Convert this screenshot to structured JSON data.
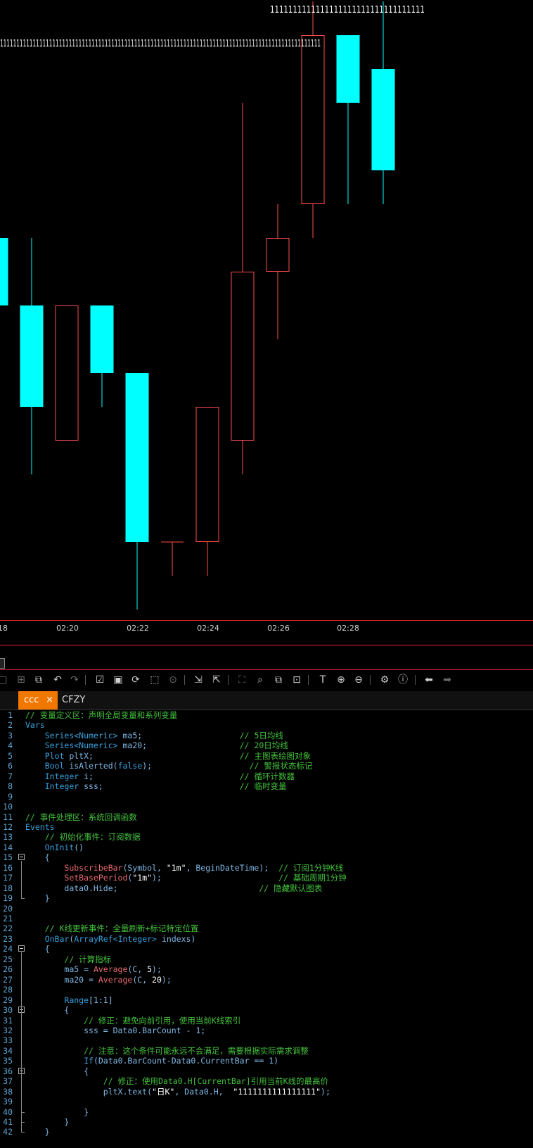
{
  "chart": {
    "top_labels": [
      "1111111111111111111111111111111111",
      "11111111111111111111111111111111111111111111111111111111111111111111111111111111111111111111111111"
    ],
    "time_labels": [
      "18",
      "02:20",
      "02:22",
      "02:24",
      "02:26",
      "02:28"
    ],
    "colors": {
      "up": "#ff4d4d",
      "down": "#00ffff",
      "axis": "#dd2222"
    },
    "candles": [
      {
        "kind": "down",
        "open": 11,
        "close": 9,
        "high": null,
        "low": null
      },
      {
        "kind": "down",
        "open": 9,
        "close": 6,
        "high": 11,
        "low": 4
      },
      {
        "kind": "up",
        "open": 5,
        "close": 9,
        "high": null,
        "low": null
      },
      {
        "kind": "down",
        "open": 9,
        "close": 7,
        "high": null,
        "low": 6
      },
      {
        "kind": "down",
        "open": 7,
        "close": 2,
        "high": null,
        "low": 0
      },
      {
        "kind": "flat",
        "open": 2,
        "close": 2,
        "high": 2,
        "low": 1
      },
      {
        "kind": "up",
        "open": 2,
        "close": 6,
        "high": null,
        "low": 1
      },
      {
        "kind": "up",
        "open": 5,
        "close": 10,
        "high": 15,
        "low": 4
      },
      {
        "kind": "up",
        "open": 10,
        "close": 11,
        "high": 12,
        "low": 8
      },
      {
        "kind": "up",
        "open": 12,
        "close": 17,
        "high": 18,
        "low": 11
      },
      {
        "kind": "down",
        "open": 17,
        "close": 15,
        "high": null,
        "low": 12
      },
      {
        "kind": "down",
        "open": 16,
        "close": 13,
        "high": 18,
        "low": 12
      }
    ]
  },
  "toolbar": {
    "icons": [
      "box-icon",
      "add-icon",
      "copy-icon",
      "undo-icon",
      "redo-icon",
      "check-icon",
      "check-file-icon",
      "refresh-icon",
      "select-icon",
      "stop-icon",
      "import-icon",
      "export-icon",
      "capture-icon",
      "search-icon",
      "find-replace-icon",
      "zoom-find-icon",
      "text-icon",
      "zoom-in-icon",
      "zoom-out-icon",
      "gear-icon",
      "info-icon",
      "back-arrow-icon",
      "forward-arrow-icon"
    ]
  },
  "tabs": [
    {
      "label": "ccc",
      "close": "×",
      "active": true
    },
    {
      "label": "CFZY",
      "active": false
    }
  ],
  "editor": {
    "lines": [
      [
        [
          "c-cm",
          "// 变量定义区：声明全局变量和系列变量"
        ]
      ],
      [
        [
          "c-kw",
          "Vars"
        ]
      ],
      [
        [
          "c-pl",
          "    "
        ],
        [
          "c-ty",
          "Series<Numeric>"
        ],
        [
          "c-id",
          " ma5;"
        ],
        [
          "c-pl",
          "                    "
        ],
        [
          "c-cm",
          "// 5日均线"
        ]
      ],
      [
        [
          "c-pl",
          "    "
        ],
        [
          "c-ty",
          "Series<Numeric>"
        ],
        [
          "c-id",
          " ma20;"
        ],
        [
          "c-pl",
          "                   "
        ],
        [
          "c-cm",
          "// 20日均线"
        ]
      ],
      [
        [
          "c-pl",
          "    "
        ],
        [
          "c-ty",
          "Plot"
        ],
        [
          "c-id",
          " pltX;"
        ],
        [
          "c-pl",
          "                              "
        ],
        [
          "c-cm",
          "// 主图表绘图对象"
        ]
      ],
      [
        [
          "c-pl",
          "    "
        ],
        [
          "c-ty",
          "Bool"
        ],
        [
          "c-id",
          " isAlerted("
        ],
        [
          "c-kw",
          "false"
        ],
        [
          "c-id",
          ");"
        ],
        [
          "c-pl",
          "                    "
        ],
        [
          "c-cm",
          "// 警报状态标记"
        ]
      ],
      [
        [
          "c-pl",
          "    "
        ],
        [
          "c-ty",
          "Integer"
        ],
        [
          "c-id",
          " i;"
        ],
        [
          "c-pl",
          "                              "
        ],
        [
          "c-cm",
          "// 循环计数器"
        ]
      ],
      [
        [
          "c-pl",
          "    "
        ],
        [
          "c-ty",
          "Integer"
        ],
        [
          "c-id",
          " sss;"
        ],
        [
          "c-pl",
          "                            "
        ],
        [
          "c-cm",
          "// 临时变量"
        ]
      ],
      [],
      [],
      [
        [
          "c-cm",
          "// 事件处理区：系统回调函数"
        ]
      ],
      [
        [
          "c-kw",
          "Events"
        ]
      ],
      [
        [
          "c-pl",
          "    "
        ],
        [
          "c-cm",
          "// 初始化事件：订阅数据"
        ]
      ],
      [
        [
          "c-pl",
          "    "
        ],
        [
          "c-kw",
          "OnInit"
        ],
        [
          "c-id",
          "()"
        ]
      ],
      [
        [
          "c-pl",
          "    "
        ],
        [
          "c-id",
          "{"
        ]
      ],
      [
        [
          "c-pl",
          "        "
        ],
        [
          "c-fn",
          "SubscribeBar"
        ],
        [
          "c-id",
          "(Symbol, "
        ],
        [
          "c-st",
          "\"1m\""
        ],
        [
          "c-id",
          ", BeginDateTime);"
        ],
        [
          "c-pl",
          "  "
        ],
        [
          "c-cm",
          "// 订阅1分钟K线"
        ]
      ],
      [
        [
          "c-pl",
          "        "
        ],
        [
          "c-fn",
          "SetBasePeriod"
        ],
        [
          "c-id",
          "("
        ],
        [
          "c-st",
          "\"1m\""
        ],
        [
          "c-id",
          ");"
        ],
        [
          "c-pl",
          "                        "
        ],
        [
          "c-cm",
          "// 基础周期1分钟"
        ]
      ],
      [
        [
          "c-pl",
          "        "
        ],
        [
          "c-id",
          "data0.Hide;"
        ],
        [
          "c-pl",
          "                             "
        ],
        [
          "c-cm",
          "// 隐藏默认图表"
        ]
      ],
      [
        [
          "c-pl",
          "    "
        ],
        [
          "c-id",
          "}"
        ]
      ],
      [],
      [],
      [
        [
          "c-pl",
          "    "
        ],
        [
          "c-cm",
          "// K线更新事件：全量刷新+标记特定位置"
        ]
      ],
      [
        [
          "c-pl",
          "    "
        ],
        [
          "c-kw",
          "OnBar"
        ],
        [
          "c-id",
          "("
        ],
        [
          "c-ty",
          "ArrayRef<Integer>"
        ],
        [
          "c-id",
          " indexs)"
        ]
      ],
      [
        [
          "c-pl",
          "    "
        ],
        [
          "c-id",
          "{"
        ]
      ],
      [
        [
          "c-pl",
          "        "
        ],
        [
          "c-cm",
          "// 计算指标"
        ]
      ],
      [
        [
          "c-pl",
          "        "
        ],
        [
          "c-id",
          "ma5 = "
        ],
        [
          "c-fn",
          "Average"
        ],
        [
          "c-id",
          "(C, "
        ],
        [
          "c-nm",
          "5"
        ],
        [
          "c-id",
          ");"
        ]
      ],
      [
        [
          "c-pl",
          "        "
        ],
        [
          "c-id",
          "ma20 = "
        ],
        [
          "c-fn",
          "Average"
        ],
        [
          "c-id",
          "(C, "
        ],
        [
          "c-nm",
          "20"
        ],
        [
          "c-id",
          ");"
        ]
      ],
      [],
      [
        [
          "c-pl",
          "        "
        ],
        [
          "c-kw",
          "Range"
        ],
        [
          "c-id",
          "[1:1]"
        ]
      ],
      [
        [
          "c-pl",
          "        "
        ],
        [
          "c-id",
          "{"
        ]
      ],
      [
        [
          "c-pl",
          "            "
        ],
        [
          "c-cm",
          "// 修正：避免向前引用，使用当前K线索引"
        ]
      ],
      [
        [
          "c-pl",
          "            "
        ],
        [
          "c-id",
          "sss = Data0.BarCount - 1;"
        ]
      ],
      [],
      [
        [
          "c-pl",
          "            "
        ],
        [
          "c-cm",
          "// 注意：这个条件可能永远不会满足，需要根据实际需求调整"
        ]
      ],
      [
        [
          "c-pl",
          "            "
        ],
        [
          "c-kw",
          "If"
        ],
        [
          "c-id",
          "(Data0.BarCount-Data0.CurrentBar == 1)"
        ]
      ],
      [
        [
          "c-pl",
          "            "
        ],
        [
          "c-id",
          "{"
        ]
      ],
      [
        [
          "c-pl",
          "                "
        ],
        [
          "c-cm",
          "// 修正：使用Data0.H[CurrentBar]引用当前K线的最高价"
        ]
      ],
      [
        [
          "c-pl",
          "                "
        ],
        [
          "c-id",
          "pltX.text("
        ],
        [
          "c-st",
          "\"日K\""
        ],
        [
          "c-id",
          ", Data0.H,  "
        ],
        [
          "c-st",
          "\"1111111111111111\""
        ],
        [
          "c-id",
          ");"
        ]
      ],
      [],
      [
        [
          "c-pl",
          "            "
        ],
        [
          "c-id",
          "}"
        ]
      ],
      [
        [
          "c-pl",
          "        "
        ],
        [
          "c-id",
          "}"
        ]
      ],
      [
        [
          "c-pl",
          "    "
        ],
        [
          "c-id",
          "}"
        ]
      ]
    ]
  }
}
